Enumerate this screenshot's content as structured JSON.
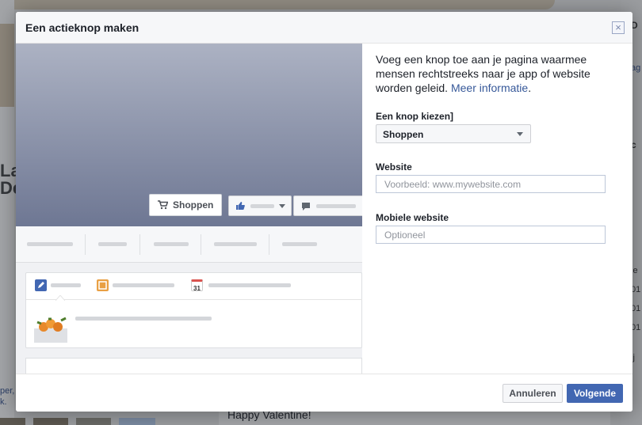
{
  "background": {
    "left_name": "La\nDe",
    "left_link": "per,\nk.",
    "right_texts": [
      "D",
      "ag",
      "c",
      "le",
      "01",
      "01",
      "01",
      "ij"
    ],
    "bottom_post_text": "Happy Valentine!"
  },
  "dialog": {
    "title": "Een actieknop maken",
    "close_icon": "×",
    "preview": {
      "cta_button_label": "Shoppen",
      "calendar_day": "31"
    },
    "form": {
      "intro_text": "Voeg een knop toe aan je pagina waarmee mensen rechtstreeks naar je app of website worden geleid. ",
      "intro_link": "Meer informatie",
      "intro_end": ".",
      "button_choice_label": "Een knop kiezen]",
      "button_choice_value": "Shoppen",
      "website_label": "Website",
      "website_placeholder": "Voorbeeld: www.mywebsite.com",
      "mobile_label": "Mobiele website",
      "mobile_placeholder": "Optioneel"
    },
    "footer": {
      "cancel_label": "Annuleren",
      "next_label": "Volgende"
    }
  },
  "colors": {
    "primary": "#4267b2",
    "link": "#365899"
  }
}
